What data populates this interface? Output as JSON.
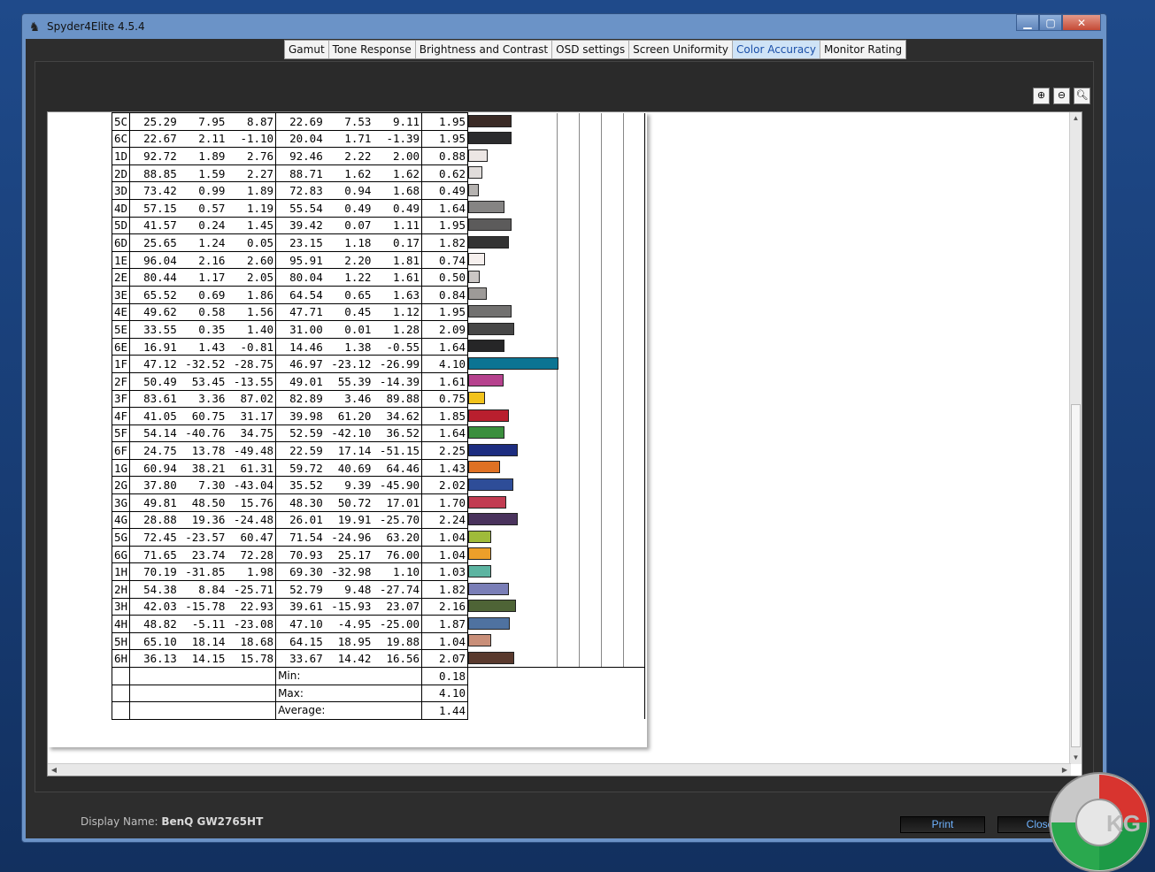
{
  "window": {
    "title": "Spyder4Elite 4.5.4"
  },
  "tabs": [
    {
      "label": "Gamut",
      "active": false
    },
    {
      "label": "Tone Response",
      "active": false
    },
    {
      "label": "Brightness and Contrast",
      "active": false
    },
    {
      "label": "OSD settings",
      "active": false
    },
    {
      "label": "Screen Uniformity",
      "active": false
    },
    {
      "label": "Color Accuracy",
      "active": true
    },
    {
      "label": "Monitor Rating",
      "active": false
    }
  ],
  "zoom": {
    "in_icon": "zoom-in-icon",
    "out_icon": "zoom-out-icon",
    "fit_icon": "zoom-fit-icon"
  },
  "report": {
    "rows": [
      {
        "id": "5C",
        "a": [
          "25.29",
          "7.95",
          "8.87"
        ],
        "b": [
          "22.69",
          "7.53",
          "9.11"
        ],
        "de": "1.95",
        "color": "#3a2a25"
      },
      {
        "id": "6C",
        "a": [
          "22.67",
          "2.11",
          "-1.10"
        ],
        "b": [
          "20.04",
          "1.71",
          "-1.39"
        ],
        "de": "1.95",
        "color": "#2b2b2d"
      },
      {
        "id": "1D",
        "a": [
          "92.72",
          "1.89",
          "2.76"
        ],
        "b": [
          "92.46",
          "2.22",
          "2.00"
        ],
        "de": "0.88",
        "color": "#ece6e4"
      },
      {
        "id": "2D",
        "a": [
          "88.85",
          "1.59",
          "2.27"
        ],
        "b": [
          "88.71",
          "1.62",
          "1.62"
        ],
        "de": "0.62",
        "color": "#e0dcda"
      },
      {
        "id": "3D",
        "a": [
          "73.42",
          "0.99",
          "1.89"
        ],
        "b": [
          "72.83",
          "0.94",
          "1.68"
        ],
        "de": "0.49",
        "color": "#b5b2b0"
      },
      {
        "id": "4D",
        "a": [
          "57.15",
          "0.57",
          "1.19"
        ],
        "b": [
          "55.54",
          "0.49",
          "0.49"
        ],
        "de": "1.64",
        "color": "#858483"
      },
      {
        "id": "5D",
        "a": [
          "41.57",
          "0.24",
          "1.45"
        ],
        "b": [
          "39.42",
          "0.07",
          "1.11"
        ],
        "de": "1.95",
        "color": "#5c5b5b"
      },
      {
        "id": "6D",
        "a": [
          "25.65",
          "1.24",
          "0.05"
        ],
        "b": [
          "23.15",
          "1.18",
          "0.17"
        ],
        "de": "1.82",
        "color": "#333333"
      },
      {
        "id": "1E",
        "a": [
          "96.04",
          "2.16",
          "2.60"
        ],
        "b": [
          "95.91",
          "2.20",
          "1.81"
        ],
        "de": "0.74",
        "color": "#f6f0ee"
      },
      {
        "id": "2E",
        "a": [
          "80.44",
          "1.17",
          "2.05"
        ],
        "b": [
          "80.04",
          "1.22",
          "1.61"
        ],
        "de": "0.50",
        "color": "#cbc7c5"
      },
      {
        "id": "3E",
        "a": [
          "65.52",
          "0.69",
          "1.86"
        ],
        "b": [
          "64.54",
          "0.65",
          "1.63"
        ],
        "de": "0.84",
        "color": "#9d9a98"
      },
      {
        "id": "4E",
        "a": [
          "49.62",
          "0.58",
          "1.56"
        ],
        "b": [
          "47.71",
          "0.45",
          "1.12"
        ],
        "de": "1.95",
        "color": "#727170"
      },
      {
        "id": "5E",
        "a": [
          "33.55",
          "0.35",
          "1.40"
        ],
        "b": [
          "31.00",
          "0.01",
          "1.28"
        ],
        "de": "2.09",
        "color": "#474747"
      },
      {
        "id": "6E",
        "a": [
          "16.91",
          "1.43",
          "-0.81"
        ],
        "b": [
          "14.46",
          "1.38",
          "-0.55"
        ],
        "de": "1.64",
        "color": "#262627"
      },
      {
        "id": "1F",
        "a": [
          "47.12",
          "-32.52",
          "-28.75"
        ],
        "b": [
          "46.97",
          "-23.12",
          "-26.99"
        ],
        "de": "4.10",
        "color": "#0b7493"
      },
      {
        "id": "2F",
        "a": [
          "50.49",
          "53.45",
          "-13.55"
        ],
        "b": [
          "49.01",
          "55.39",
          "-14.39"
        ],
        "de": "1.61",
        "color": "#b6428e"
      },
      {
        "id": "3F",
        "a": [
          "83.61",
          "3.36",
          "87.02"
        ],
        "b": [
          "82.89",
          "3.46",
          "89.88"
        ],
        "de": "0.75",
        "color": "#f2c31c"
      },
      {
        "id": "4F",
        "a": [
          "41.05",
          "60.75",
          "31.17"
        ],
        "b": [
          "39.98",
          "61.20",
          "34.62"
        ],
        "de": "1.85",
        "color": "#b91f2e"
      },
      {
        "id": "5F",
        "a": [
          "54.14",
          "-40.76",
          "34.75"
        ],
        "b": [
          "52.59",
          "-42.10",
          "36.52"
        ],
        "de": "1.64",
        "color": "#3b8f3d"
      },
      {
        "id": "6F",
        "a": [
          "24.75",
          "13.78",
          "-49.48"
        ],
        "b": [
          "22.59",
          "17.14",
          "-51.15"
        ],
        "de": "2.25",
        "color": "#1d2d80"
      },
      {
        "id": "1G",
        "a": [
          "60.94",
          "38.21",
          "61.31"
        ],
        "b": [
          "59.72",
          "40.69",
          "64.46"
        ],
        "de": "1.43",
        "color": "#df7124"
      },
      {
        "id": "2G",
        "a": [
          "37.80",
          "7.30",
          "-43.04"
        ],
        "b": [
          "35.52",
          "9.39",
          "-45.90"
        ],
        "de": "2.02",
        "color": "#2e4d98"
      },
      {
        "id": "3G",
        "a": [
          "49.81",
          "48.50",
          "15.76"
        ],
        "b": [
          "48.30",
          "50.72",
          "17.01"
        ],
        "de": "1.70",
        "color": "#c23c52"
      },
      {
        "id": "4G",
        "a": [
          "28.88",
          "19.36",
          "-24.48"
        ],
        "b": [
          "26.01",
          "19.91",
          "-25.70"
        ],
        "de": "2.24",
        "color": "#4a335d"
      },
      {
        "id": "5G",
        "a": [
          "72.45",
          "-23.57",
          "60.47"
        ],
        "b": [
          "71.54",
          "-24.96",
          "63.20"
        ],
        "de": "1.04",
        "color": "#9fbb3a"
      },
      {
        "id": "6G",
        "a": [
          "71.65",
          "23.74",
          "72.28"
        ],
        "b": [
          "70.93",
          "25.17",
          "76.00"
        ],
        "de": "1.04",
        "color": "#ec9f2a"
      },
      {
        "id": "1H",
        "a": [
          "70.19",
          "-31.85",
          "1.98"
        ],
        "b": [
          "69.30",
          "-32.98",
          "1.10"
        ],
        "de": "1.03",
        "color": "#5cb4a1"
      },
      {
        "id": "2H",
        "a": [
          "54.38",
          "8.84",
          "-25.71"
        ],
        "b": [
          "52.79",
          "9.48",
          "-27.74"
        ],
        "de": "1.82",
        "color": "#7a7eb7"
      },
      {
        "id": "3H",
        "a": [
          "42.03",
          "-15.78",
          "22.93"
        ],
        "b": [
          "39.61",
          "-15.93",
          "23.07"
        ],
        "de": "2.16",
        "color": "#4e6436"
      },
      {
        "id": "4H",
        "a": [
          "48.82",
          "-5.11",
          "-23.08"
        ],
        "b": [
          "47.10",
          "-4.95",
          "-25.00"
        ],
        "de": "1.87",
        "color": "#4f72a0"
      },
      {
        "id": "5H",
        "a": [
          "65.10",
          "18.14",
          "18.68"
        ],
        "b": [
          "64.15",
          "18.95",
          "19.88"
        ],
        "de": "1.04",
        "color": "#c98f79"
      },
      {
        "id": "6H",
        "a": [
          "36.13",
          "14.15",
          "15.78"
        ],
        "b": [
          "33.67",
          "14.42",
          "16.56"
        ],
        "de": "2.07",
        "color": "#5a3a2e"
      }
    ],
    "summary": [
      {
        "label": "Min:",
        "value": "0.18"
      },
      {
        "label": "Max:",
        "value": "4.10"
      },
      {
        "label": "Average:",
        "value": "1.44"
      }
    ]
  },
  "footer": {
    "display_label": "Display Name:",
    "display_value": "BenQ GW2765HT",
    "print_label": "Print",
    "close_label": "Close"
  },
  "logo": {
    "text": "KG"
  }
}
